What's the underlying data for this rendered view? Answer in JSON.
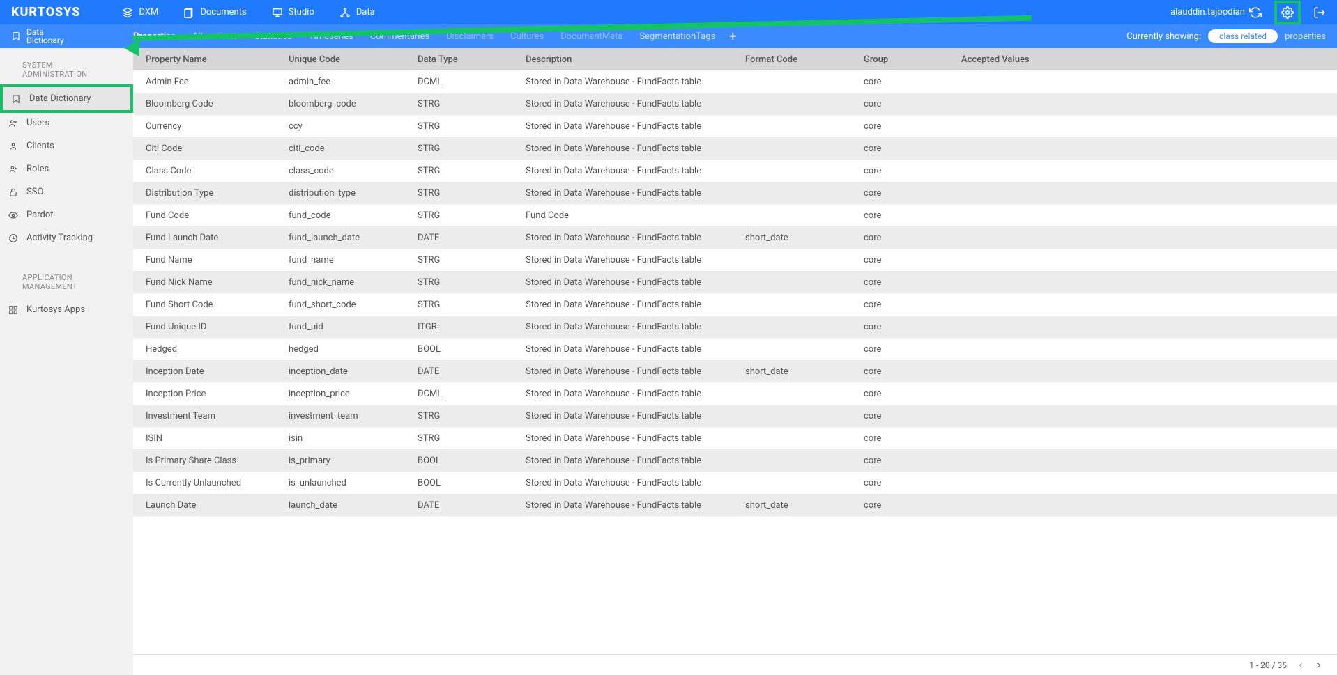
{
  "brand": "KURTOSYS",
  "topnav": [
    {
      "label": "DXM",
      "icon": "layers"
    },
    {
      "label": "Documents",
      "icon": "docs"
    },
    {
      "label": "Studio",
      "icon": "studio"
    },
    {
      "label": "Data",
      "icon": "data"
    }
  ],
  "user": {
    "name": "alauddin.tajoodian"
  },
  "subheader": {
    "title_line1": "Data",
    "title_line2": "Dictionary",
    "tabs": [
      {
        "label": "Properties",
        "state": "active"
      },
      {
        "label": "Allocations",
        "state": "normal"
      },
      {
        "label": "Statistics",
        "state": "normal"
      },
      {
        "label": "Timeseries",
        "state": "normal"
      },
      {
        "label": "Commentaries",
        "state": "normal"
      },
      {
        "label": "Disclaimers",
        "state": "faded"
      },
      {
        "label": "Cultures",
        "state": "faded"
      },
      {
        "label": "DocumentMeta",
        "state": "faded"
      },
      {
        "label": "SegmentationTags",
        "state": "normal"
      }
    ],
    "showing_label": "Currently showing:",
    "pill": "class related",
    "suffix": "properties"
  },
  "sidebar": {
    "section1": "SYSTEM ADMINISTRATION",
    "items1": [
      {
        "label": "Data Dictionary",
        "icon": "bookmark",
        "active": true
      },
      {
        "label": "Users",
        "icon": "users"
      },
      {
        "label": "Clients",
        "icon": "person"
      },
      {
        "label": "Roles",
        "icon": "person-plus"
      },
      {
        "label": "SSO",
        "icon": "lock"
      },
      {
        "label": "Pardot",
        "icon": "eye"
      },
      {
        "label": "Activity Tracking",
        "icon": "clock"
      }
    ],
    "section2": "APPLICATION MANAGEMENT",
    "items2": [
      {
        "label": "Kurtosys Apps",
        "icon": "grid"
      }
    ]
  },
  "table": {
    "headers": [
      "Property Name",
      "Unique Code",
      "Data Type",
      "Description",
      "Format Code",
      "Group",
      "Accepted Values"
    ],
    "rows": [
      {
        "name": "Admin Fee",
        "code": "admin_fee",
        "type": "DCML",
        "desc": "Stored in Data Warehouse - FundFacts table",
        "format": "",
        "group": "core",
        "accepted": ""
      },
      {
        "name": "Bloomberg Code",
        "code": "bloomberg_code",
        "type": "STRG",
        "desc": "Stored in Data Warehouse - FundFacts table",
        "format": "",
        "group": "core",
        "accepted": ""
      },
      {
        "name": "Currency",
        "code": "ccy",
        "type": "STRG",
        "desc": "Stored in Data Warehouse - FundFacts table",
        "format": "",
        "group": "core",
        "accepted": ""
      },
      {
        "name": "Citi Code",
        "code": "citi_code",
        "type": "STRG",
        "desc": "Stored in Data Warehouse - FundFacts table",
        "format": "",
        "group": "core",
        "accepted": ""
      },
      {
        "name": "Class Code",
        "code": "class_code",
        "type": "STRG",
        "desc": "Stored in Data Warehouse - FundFacts table",
        "format": "",
        "group": "core",
        "accepted": ""
      },
      {
        "name": "Distribution Type",
        "code": "distribution_type",
        "type": "STRG",
        "desc": "Stored in Data Warehouse - FundFacts table",
        "format": "",
        "group": "core",
        "accepted": ""
      },
      {
        "name": "Fund Code",
        "code": "fund_code",
        "type": "STRG",
        "desc": "Fund Code",
        "format": "",
        "group": "core",
        "accepted": ""
      },
      {
        "name": "Fund Launch Date",
        "code": "fund_launch_date",
        "type": "DATE",
        "desc": "Stored in Data Warehouse - FundFacts table",
        "format": "short_date",
        "group": "core",
        "accepted": ""
      },
      {
        "name": "Fund Name",
        "code": "fund_name",
        "type": "STRG",
        "desc": "Stored in Data Warehouse - FundFacts table",
        "format": "",
        "group": "core",
        "accepted": ""
      },
      {
        "name": "Fund Nick Name",
        "code": "fund_nick_name",
        "type": "STRG",
        "desc": "Stored in Data Warehouse - FundFacts table",
        "format": "",
        "group": "core",
        "accepted": ""
      },
      {
        "name": "Fund Short Code",
        "code": "fund_short_code",
        "type": "STRG",
        "desc": "Stored in Data Warehouse - FundFacts table",
        "format": "",
        "group": "core",
        "accepted": ""
      },
      {
        "name": "Fund Unique ID",
        "code": "fund_uid",
        "type": "ITGR",
        "desc": "Stored in Data Warehouse - FundFacts table",
        "format": "",
        "group": "core",
        "accepted": ""
      },
      {
        "name": "Hedged",
        "code": "hedged",
        "type": "BOOL",
        "desc": "Stored in Data Warehouse - FundFacts table",
        "format": "",
        "group": "core",
        "accepted": ""
      },
      {
        "name": "Inception Date",
        "code": "inception_date",
        "type": "DATE",
        "desc": "Stored in Data Warehouse - FundFacts table",
        "format": "short_date",
        "group": "core",
        "accepted": ""
      },
      {
        "name": "Inception Price",
        "code": "inception_price",
        "type": "DCML",
        "desc": "Stored in Data Warehouse - FundFacts table",
        "format": "",
        "group": "core",
        "accepted": ""
      },
      {
        "name": "Investment Team",
        "code": "investment_team",
        "type": "STRG",
        "desc": "Stored in Data Warehouse - FundFacts table",
        "format": "",
        "group": "core",
        "accepted": ""
      },
      {
        "name": "ISIN",
        "code": "isin",
        "type": "STRG",
        "desc": "Stored in Data Warehouse - FundFacts table",
        "format": "",
        "group": "core",
        "accepted": ""
      },
      {
        "name": "Is Primary Share Class",
        "code": "is_primary",
        "type": "BOOL",
        "desc": "Stored in Data Warehouse - FundFacts table",
        "format": "",
        "group": "core",
        "accepted": ""
      },
      {
        "name": "Is Currently Unlaunched",
        "code": "is_unlaunched",
        "type": "BOOL",
        "desc": "Stored in Data Warehouse - FundFacts table",
        "format": "",
        "group": "core",
        "accepted": ""
      },
      {
        "name": "Launch Date",
        "code": "launch_date",
        "type": "DATE",
        "desc": "Stored in Data Warehouse - FundFacts table",
        "format": "short_date",
        "group": "core",
        "accepted": ""
      }
    ]
  },
  "footer": {
    "range": "1 - 20 / 35"
  }
}
